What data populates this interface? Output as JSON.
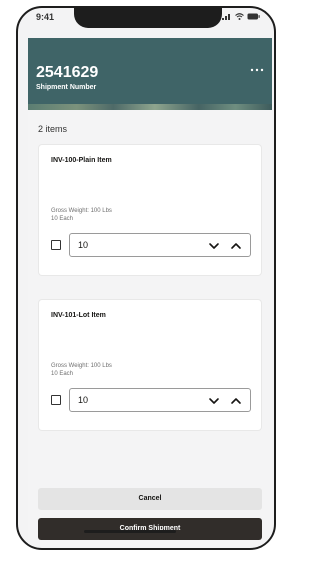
{
  "status_bar": {
    "time": "9:41"
  },
  "header": {
    "shipment_number": "2541629",
    "shipment_label": "Shipment Number",
    "background_color": "#3f6467"
  },
  "items_count": "2 items",
  "items": [
    {
      "title": "INV-100-Plain Item",
      "gross_weight": "Gross Weight: 100 Lbs",
      "uom": "10 Each",
      "quantity": "10",
      "checked": false
    },
    {
      "title": "INV-101-Lot Item",
      "gross_weight": "Gross Weight: 100 Lbs",
      "uom": "10 Each",
      "quantity": "10",
      "checked": false
    }
  ],
  "buttons": {
    "cancel": "Cancel",
    "confirm": "Confirm Shipment"
  },
  "icons": {
    "more": "more-horizontal-icon",
    "down": "chevron-down-icon",
    "up": "chevron-up-icon"
  }
}
